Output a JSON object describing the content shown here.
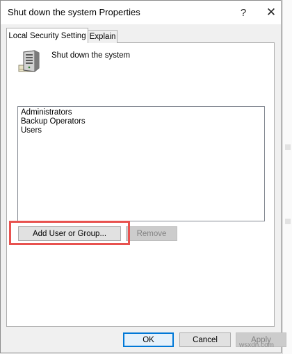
{
  "window": {
    "title": "Shut down the system Properties",
    "help_glyph": "?",
    "close_glyph": "✕"
  },
  "tabs": [
    {
      "label": "Local Security Setting",
      "active": true
    },
    {
      "label": "Explain",
      "active": false
    }
  ],
  "policy": {
    "name": "Shut down the system",
    "icon": "server-icon"
  },
  "members": [
    "Administrators",
    "Backup Operators",
    "Users"
  ],
  "actions": {
    "add_label": "Add User or Group...",
    "remove_label": "Remove",
    "remove_enabled": false
  },
  "footer": {
    "ok_label": "OK",
    "cancel_label": "Cancel",
    "apply_label": "Apply",
    "apply_enabled": false
  },
  "annotation": {
    "highlight_color": "#e8524f",
    "target": "add-user-or-group-button"
  },
  "watermark": "wsxdn.com",
  "colors": {
    "focus_border": "#0078d7",
    "disabled_text": "#838383"
  }
}
